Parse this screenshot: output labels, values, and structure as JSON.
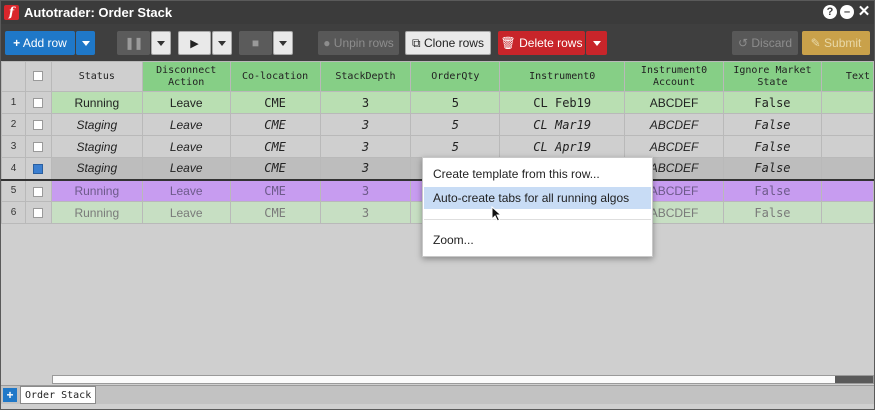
{
  "window": {
    "title": "Autotrader: Order Stack",
    "logo_letter": "f"
  },
  "title_controls": [
    "?",
    "–",
    "✕"
  ],
  "toolbar": {
    "add_row": "Add row",
    "pause_icon": "pause-icon",
    "play_icon": "play-icon",
    "stop_icon": "stop-icon",
    "unpin": "Unpin rows",
    "clone": "Clone rows",
    "delete": "Delete rows",
    "discard": "Discard",
    "submit": "Submit"
  },
  "columns": {
    "status": "Status",
    "disconnect": [
      "Disconnect",
      "Action"
    ],
    "colocation": "Co-location",
    "stackdepth": "StackDepth",
    "orderqty": "OrderQty",
    "instrument": "Instrument0",
    "account": [
      "Instrument0",
      "Account"
    ],
    "ignore": [
      "Ignore Market",
      "State"
    ],
    "text": "Text"
  },
  "rows": [
    {
      "num": "1",
      "status": "Running",
      "disconnect": "Leave",
      "colocation": "CME",
      "stackdepth": "3",
      "orderqty": "5",
      "instrument": "CL Feb19",
      "account": "ABCDEF",
      "ignore": "False",
      "text": ""
    },
    {
      "num": "2",
      "status": "Staging",
      "disconnect": "Leave",
      "colocation": "CME",
      "stackdepth": "3",
      "orderqty": "5",
      "instrument": "CL Mar19",
      "account": "ABCDEF",
      "ignore": "False",
      "text": ""
    },
    {
      "num": "3",
      "status": "Staging",
      "disconnect": "Leave",
      "colocation": "CME",
      "stackdepth": "3",
      "orderqty": "5",
      "instrument": "CL Apr19",
      "account": "ABCDEF",
      "ignore": "False",
      "text": ""
    },
    {
      "num": "4",
      "status": "Staging",
      "disconnect": "Leave",
      "colocation": "CME",
      "stackdepth": "3",
      "orderqty": "",
      "instrument": "",
      "account": "ABCDEF",
      "ignore": "False",
      "text": ""
    },
    {
      "num": "5",
      "status": "Running",
      "disconnect": "Leave",
      "colocation": "CME",
      "stackdepth": "3",
      "orderqty": "",
      "instrument": "",
      "account": "ABCDEF",
      "ignore": "False",
      "text": ""
    },
    {
      "num": "6",
      "status": "Running",
      "disconnect": "Leave",
      "colocation": "CME",
      "stackdepth": "3",
      "orderqty": "",
      "instrument": "",
      "account": "ABCDEF",
      "ignore": "False",
      "text": ""
    }
  ],
  "context_menu": {
    "items": [
      "Create template from this row...",
      "Auto-create tabs for all running algos",
      "Zoom..."
    ],
    "highlighted": "Auto-create tabs for all running algos"
  },
  "tabs": {
    "add": "+",
    "active": "Order Stack"
  },
  "colors": {
    "running_row": "#b9dfb2",
    "staging_row": "#cfcfcf",
    "purple_row": "#c79cf0",
    "header_green": "#86cf86",
    "accent_blue": "#1f78c8",
    "delete_red": "#c8252a",
    "menu_highlight": "#c8dcf5"
  }
}
